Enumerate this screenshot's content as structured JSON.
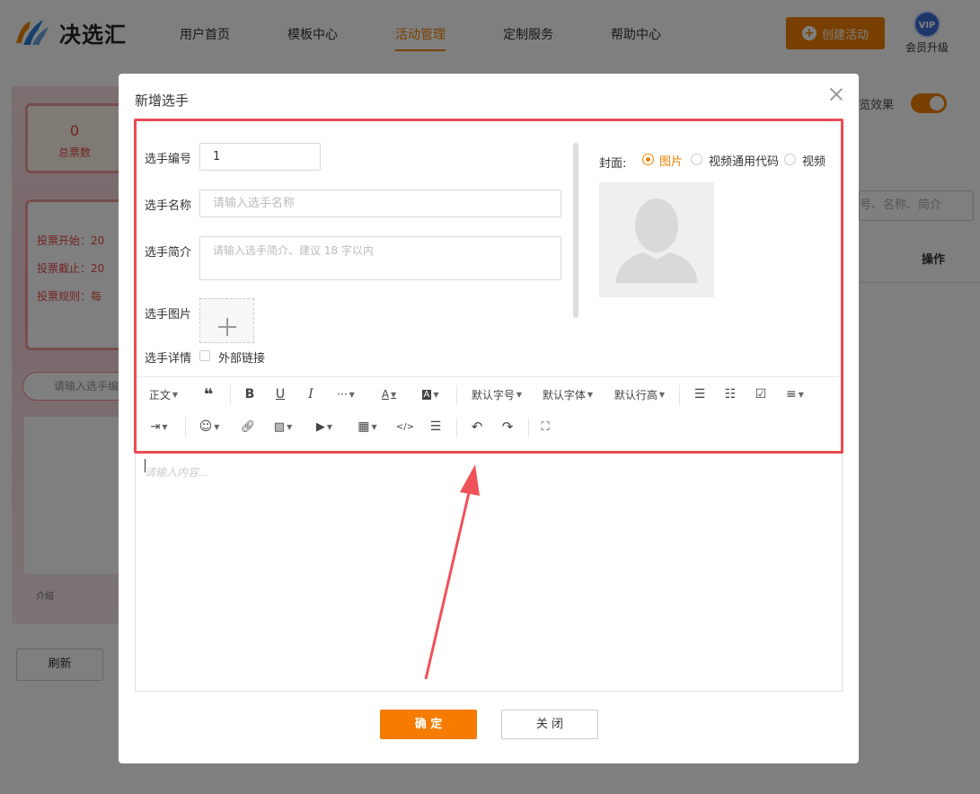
{
  "app": {
    "brand": "决选汇"
  },
  "nav": {
    "items": [
      {
        "label": "用户首页"
      },
      {
        "label": "模板中心"
      },
      {
        "label": "活动管理"
      },
      {
        "label": "定制服务"
      },
      {
        "label": "帮助中心"
      }
    ],
    "create_label": "创建活动",
    "vip_badge": "VIP",
    "vip_label": "会员升级"
  },
  "background": {
    "stat_value": "0",
    "stat_label": "总票数",
    "vote_start": "投票开始：20",
    "vote_end": "投票截止：20",
    "vote_rules": "投票规则：每",
    "search_placeholder": "请输入选手编",
    "tab_intro": "介绍",
    "refresh_label": "刷新",
    "preview_label": "览效果",
    "right_search_placeholder": "号、名称、简介",
    "op_header": "操作"
  },
  "modal": {
    "title": "新增选手",
    "fields": {
      "number_label": "选手编号",
      "number_value": "1",
      "name_label": "选手名称",
      "name_placeholder": "请输入选手名称",
      "intro_label": "选手简介",
      "intro_placeholder": "请输入选手简介、建议 18 字以内",
      "image_label": "选手图片",
      "detail_label": "选手详情",
      "external_link_label": "外部链接"
    },
    "cover": {
      "label": "封面:",
      "options": [
        {
          "label": "图片",
          "selected": true
        },
        {
          "label": "视频通用代码",
          "selected": false
        },
        {
          "label": "视频",
          "selected": false
        }
      ]
    },
    "toolbar": {
      "paragraph": "正文",
      "font_size": "默认字号",
      "font_family": "默认字体",
      "line_height": "默认行高"
    },
    "editor_placeholder": "请输入内容...",
    "confirm_label": "确 定",
    "close_label": "关 闭"
  },
  "colors": {
    "accent": "#f08000",
    "highlight": "#e94d54"
  }
}
